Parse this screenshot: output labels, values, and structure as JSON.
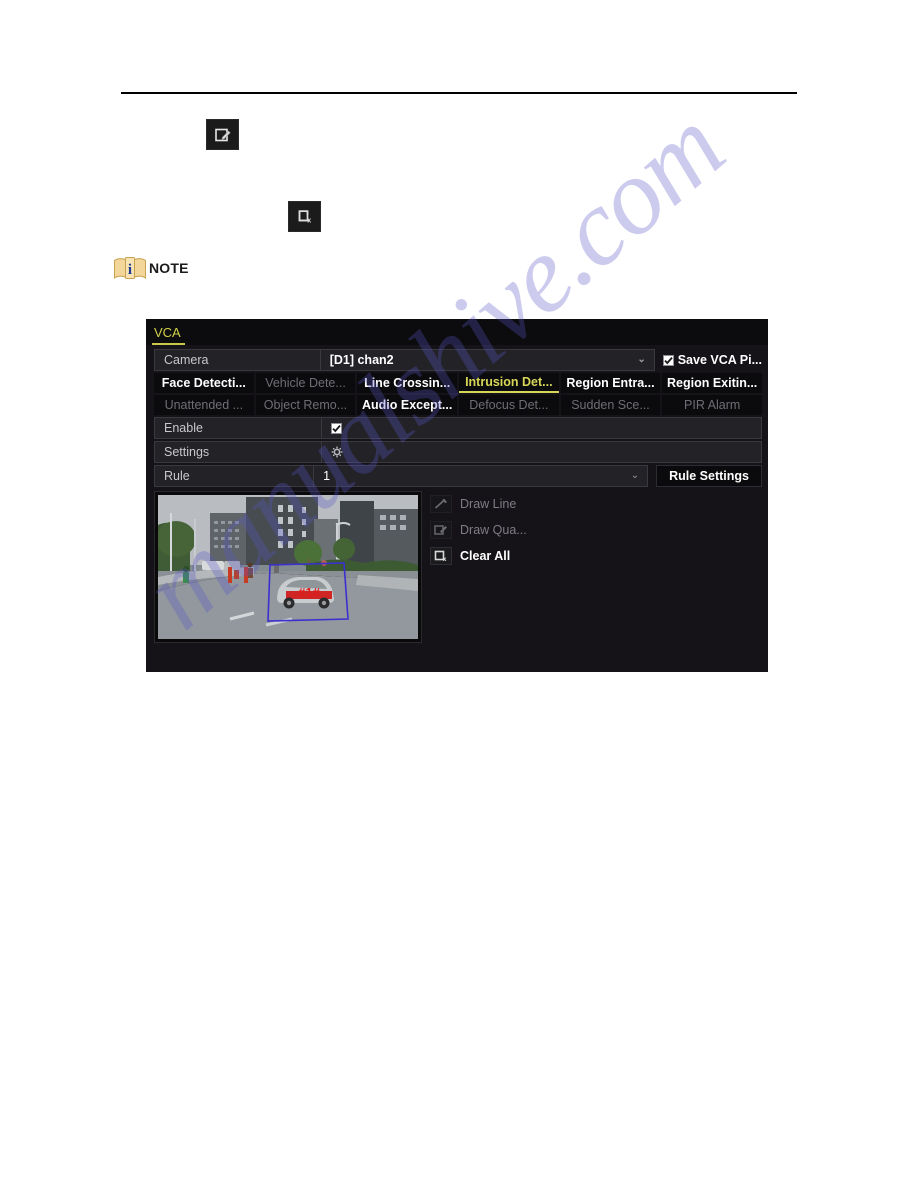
{
  "document": {
    "note_label": "NOTE",
    "inline_icons": [
      {
        "name": "draw-quadrilateral-icon",
        "title": "Draw Quadrilateral"
      },
      {
        "name": "clear-all-icon",
        "title": "Clear All"
      }
    ],
    "watermark": "manualshive.com"
  },
  "panel": {
    "tab_title": "VCA",
    "camera": {
      "label": "Camera",
      "value": "[D1] chan2",
      "caret": "⌄"
    },
    "save_vca": {
      "label": "Save VCA Pi...",
      "checked": true
    },
    "detection_tabs": [
      {
        "label": "Face Detecti...",
        "state": "enabled"
      },
      {
        "label": "Vehicle Dete...",
        "state": "disabled"
      },
      {
        "label": "Line Crossin...",
        "state": "enabled"
      },
      {
        "label": "Intrusion Det...",
        "state": "active"
      },
      {
        "label": "Region Entra...",
        "state": "enabled"
      },
      {
        "label": "Region Exitin...",
        "state": "enabled"
      },
      {
        "label": "Unattended ...",
        "state": "disabled"
      },
      {
        "label": "Object Remo...",
        "state": "disabled"
      },
      {
        "label": "Audio Except...",
        "state": "enabled"
      },
      {
        "label": "Defocus Det...",
        "state": "disabled"
      },
      {
        "label": "Sudden Sce...",
        "state": "disabled"
      },
      {
        "label": "PIR Alarm",
        "state": "disabled"
      }
    ],
    "enable": {
      "label": "Enable",
      "checked": true
    },
    "settings": {
      "label": "Settings",
      "icon": "gear-icon"
    },
    "rule": {
      "label": "Rule",
      "value": "1",
      "caret": "⌄",
      "button_label": "Rule Settings"
    },
    "tools": [
      {
        "label": "Draw Line",
        "icon": "draw-line-icon",
        "state": "disabled"
      },
      {
        "label": "Draw Qua...",
        "icon": "draw-quad-icon",
        "state": "disabled"
      },
      {
        "label": "Clear All",
        "icon": "clear-all-icon",
        "state": "enabled"
      }
    ],
    "preview": {
      "region_label": "#1#",
      "region_color": "#3b2fd0",
      "region_label_color": "#e01b1b"
    }
  },
  "colors": {
    "panel_bg": "#151317",
    "accent_yellow": "#d7d657",
    "row_bg": "#232227",
    "tab_bg": "#0b0b0d",
    "watermark": "#5a57c8"
  }
}
